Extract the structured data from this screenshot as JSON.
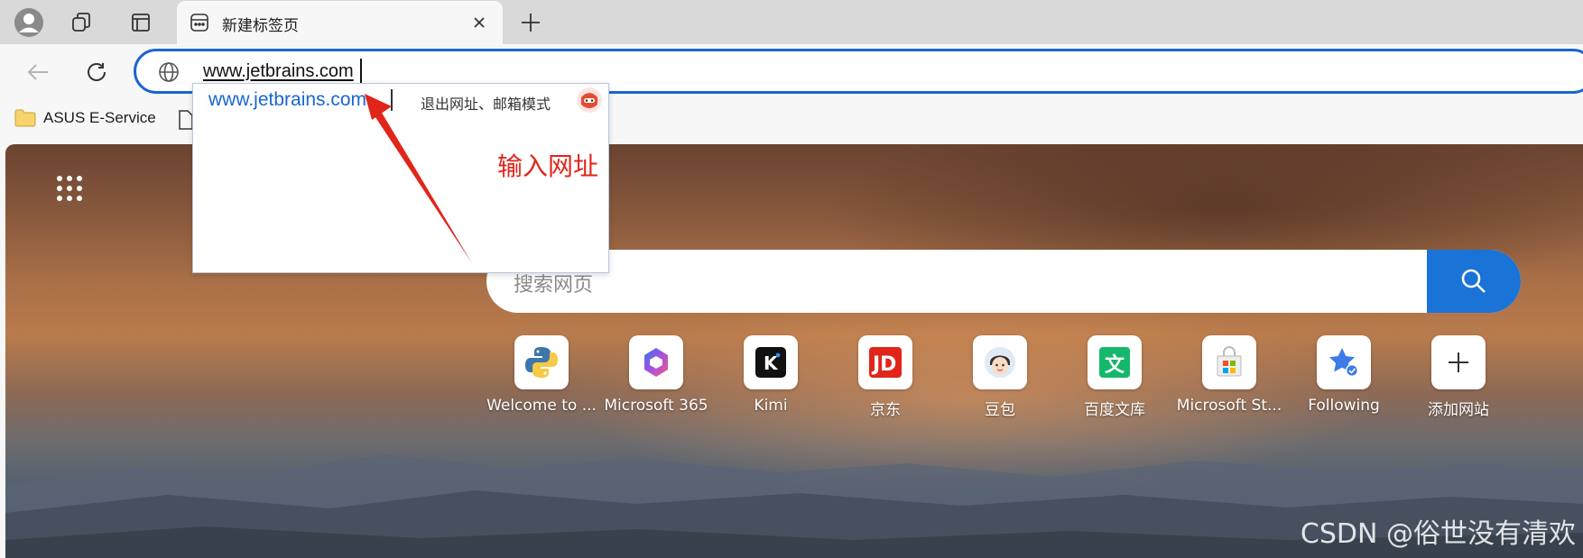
{
  "tab": {
    "title": "新建标签页"
  },
  "address_bar": {
    "value": "www.jetbrains.com"
  },
  "bookmarks": [
    {
      "label": "ASUS E-Service"
    }
  ],
  "dropdown": {
    "suggestion": "www.jetbrains.com",
    "exit_mode": "退出网址、邮箱模式"
  },
  "annotation": {
    "text": "输入网址"
  },
  "search": {
    "placeholder": "搜索网页"
  },
  "tiles": [
    {
      "label": "Welcome to ...",
      "icon": "python-icon"
    },
    {
      "label": "Microsoft 365",
      "icon": "microsoft-365-icon"
    },
    {
      "label": "Kimi",
      "icon": "kimi-icon"
    },
    {
      "label": "京东",
      "icon": "jd-icon"
    },
    {
      "label": "豆包",
      "icon": "doubao-icon"
    },
    {
      "label": "百度文库",
      "icon": "baidu-wenku-icon"
    },
    {
      "label": "Microsoft St...",
      "icon": "microsoft-store-icon"
    },
    {
      "label": "Following",
      "icon": "following-icon"
    },
    {
      "label": "添加网站",
      "icon": "plus-icon"
    }
  ],
  "watermark": "CSDN @俗世没有清欢",
  "colors": {
    "accent": "#1a66d1",
    "search_button": "#1a73d6",
    "annotation": "#e1251b"
  }
}
